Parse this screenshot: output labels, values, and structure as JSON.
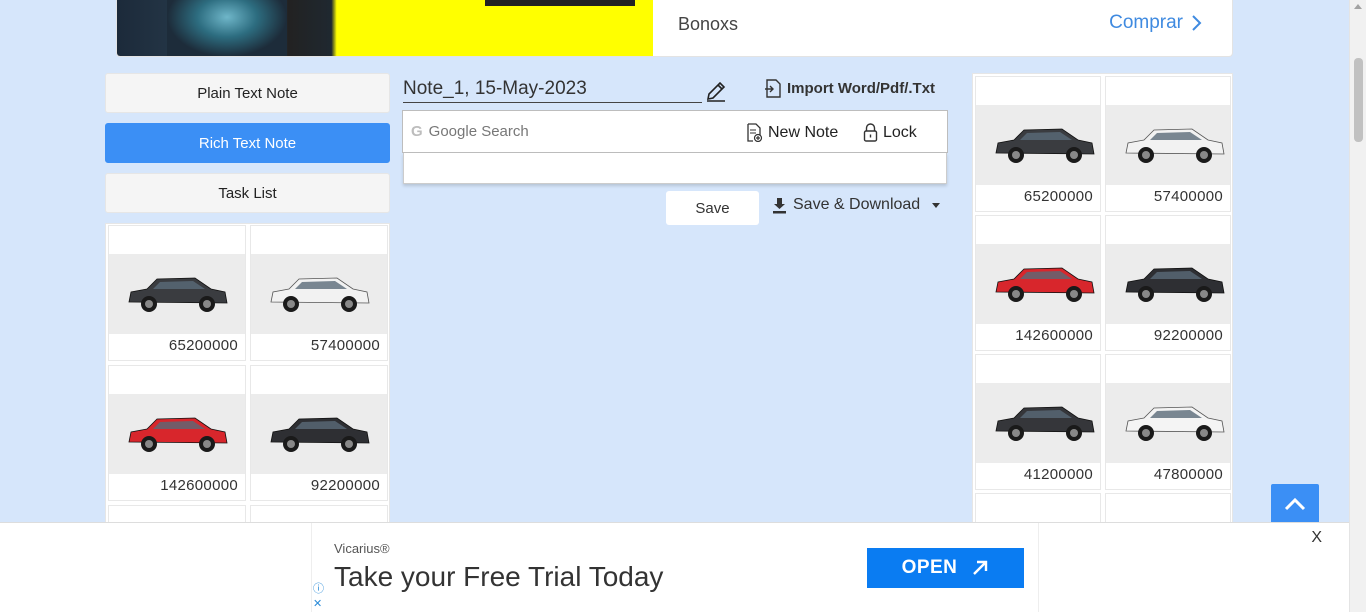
{
  "top_ad": {
    "brand": "Bonoxs",
    "cta": "Comprar",
    "chevron_icon": "chevron-right-icon"
  },
  "nav": {
    "plain_text_note": "Plain Text Note",
    "rich_text_note": "Rich Text Note",
    "task_list": "Task List"
  },
  "editor": {
    "title": "Note_1, 15-May-2023",
    "import_label": "Import Word/Pdf/.Txt",
    "search_placeholder": "Google Search",
    "search_g": "G",
    "new_note": "New Note",
    "lock": "Lock",
    "save": "Save",
    "save_download": "Save & Download"
  },
  "left_ad": {
    "items": [
      {
        "price": "65200000",
        "color": "#3a3c40"
      },
      {
        "price": "57400000",
        "color": "#f2f2f2"
      },
      {
        "price": "142600000",
        "color": "#d8262c"
      },
      {
        "price": "92200000",
        "color": "#2e2f33"
      }
    ]
  },
  "right_ad": {
    "items": [
      {
        "price": "65200000",
        "color": "#3a3c40"
      },
      {
        "price": "57400000",
        "color": "#f2f2f2"
      },
      {
        "price": "142600000",
        "color": "#d8262c"
      },
      {
        "price": "92200000",
        "color": "#2e2f33"
      },
      {
        "price": "41200000",
        "color": "#35363a"
      },
      {
        "price": "47800000",
        "color": "#f4f4f4"
      }
    ]
  },
  "bottom_ad": {
    "advertiser": "Vicarius®",
    "headline": "Take your Free Trial Today",
    "cta": "OPEN",
    "close": "X"
  },
  "colors": {
    "accent": "#3b8ff5",
    "background": "#d6e6fb",
    "ad_cta": "#0a7cf2"
  }
}
